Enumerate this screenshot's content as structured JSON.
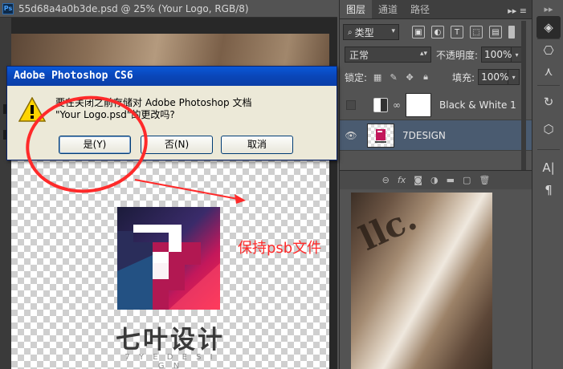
{
  "document": {
    "title": "55d68a4a0b3de.psd @ 25% (Your Logo, RGB/8)",
    "app_badge": "Ps"
  },
  "canvas": {
    "brand_cn": "七叶设计",
    "brand_en": "7 Y E D E S I G N"
  },
  "dialog": {
    "title": "Adobe Photoshop CS6",
    "message_line1": "要在关闭之前存储对 Adobe Photoshop 文档",
    "message_line2": "\"Your Logo.psd\"的更改吗?",
    "buttons": {
      "yes": "是(Y)",
      "no": "否(N)",
      "cancel": "取消"
    }
  },
  "annotation": {
    "text": "保持psb文件",
    "color": "#ff2a2a"
  },
  "layers_panel": {
    "tabs": [
      "图层",
      "通道",
      "路径"
    ],
    "filter_kind": "类型",
    "blend_mode": "正常",
    "opacity_label": "不透明度:",
    "opacity_value": "100%",
    "lock_label": "锁定:",
    "fill_label": "填充:",
    "fill_value": "100%",
    "layers": [
      {
        "name": "Black & White 1",
        "visible": false
      },
      {
        "name": "7DESIGN",
        "visible": true,
        "selected": true
      }
    ]
  },
  "colors": {
    "panel_bg": "#535353",
    "selected_layer": "#4a5b70",
    "dialog_bg": "#ece9d8",
    "titlebar": "#0a46b8"
  }
}
